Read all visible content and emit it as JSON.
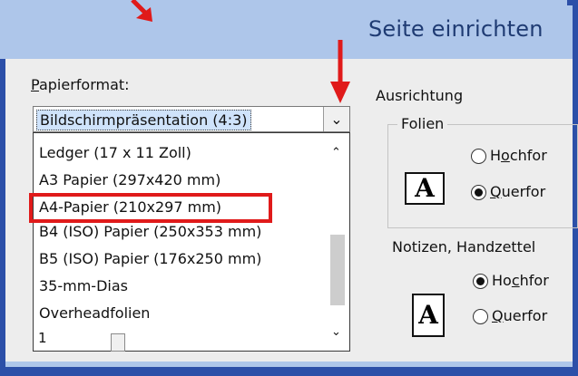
{
  "dialog": {
    "title": "Seite einrichten"
  },
  "paper": {
    "label_prefix": "P",
    "label_rest": "apierformat:",
    "selected": "Bildschirmpräsentation (4:3)",
    "options": [
      "Ledger (17 x 11 Zoll)",
      "A3 Papier (297x420 mm)",
      "A4-Papier (210x297 mm)",
      "B4 (ISO) Papier (250x353 mm)",
      "B5 (ISO) Papier (176x250 mm)",
      "35-mm-Dias",
      "Overheadfolien"
    ],
    "dropdown_icon": "chevron-down-icon"
  },
  "numbering": {
    "value": "1"
  },
  "orientation": {
    "group_label": "Ausrichtung",
    "folien": {
      "label": "Folien",
      "option1_pre": "H",
      "option1_u": "o",
      "option1_rest": "chfor",
      "option2_pre": "",
      "option2_u": "Q",
      "option2_rest": "uerfor",
      "selected": "Querformat",
      "icon_letter": "A"
    },
    "notizen": {
      "label": "Notizen, Handzettel",
      "option1_pre": "Ho",
      "option1_u": "c",
      "option1_rest": "hfor",
      "option2_pre": "",
      "option2_u": "Q",
      "option2_rest": "uerfor",
      "selected": "Hochformat",
      "icon_letter": "A"
    }
  },
  "annotation": {
    "accent_color": "#e01a1a"
  }
}
